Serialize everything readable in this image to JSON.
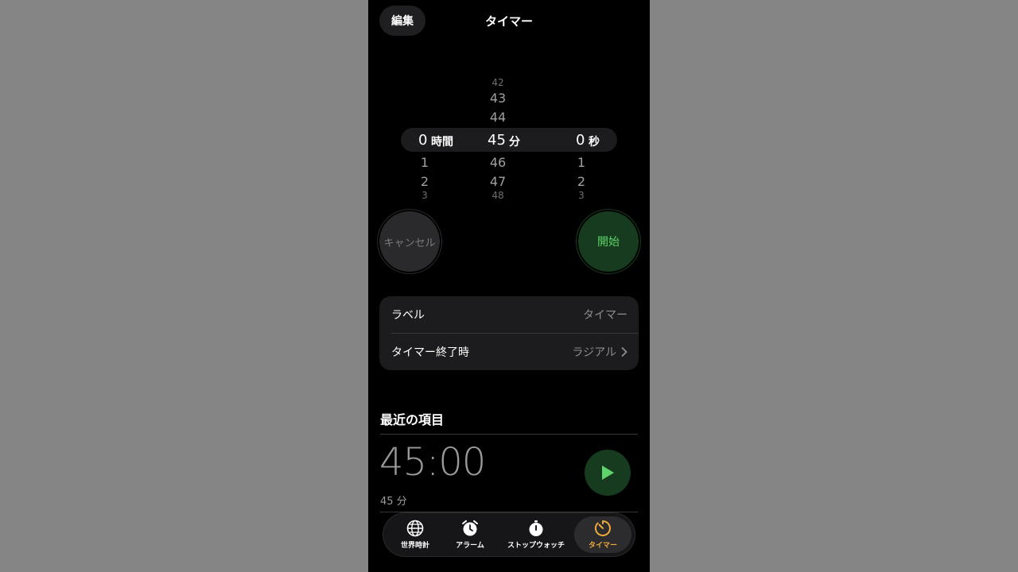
{
  "nav": {
    "edit_label": "編集",
    "title": "タイマー"
  },
  "picker": {
    "hours": {
      "above": [],
      "selected": "0",
      "unit": "時間",
      "below": [
        "1",
        "2",
        "3"
      ]
    },
    "minutes": {
      "above": [
        "42",
        "43",
        "44"
      ],
      "selected": "45",
      "unit": "分",
      "below": [
        "46",
        "47",
        "48"
      ]
    },
    "seconds": {
      "above": [],
      "selected": "0",
      "unit": "秒",
      "below": [
        "1",
        "2",
        "3"
      ]
    }
  },
  "buttons": {
    "cancel_label": "キャンセル",
    "start_label": "開始"
  },
  "settings": {
    "label_row": {
      "label": "ラベル",
      "value": "タイマー"
    },
    "end_row": {
      "label": "タイマー終了時",
      "value": "ラジアル"
    }
  },
  "recent": {
    "section_title": "最近の項目",
    "item": {
      "time": "45:00",
      "subtitle": "45 分"
    }
  },
  "tabs": [
    {
      "label": "世界時計",
      "icon": "globe-icon"
    },
    {
      "label": "アラーム",
      "icon": "alarm-clock-icon"
    },
    {
      "label": "ストップウォッチ",
      "icon": "stopwatch-icon"
    },
    {
      "label": "タイマー",
      "icon": "timer-icon",
      "active": true
    }
  ],
  "colors": {
    "accent_green": "#5ed46a",
    "accent_orange": "#f0a93a"
  }
}
